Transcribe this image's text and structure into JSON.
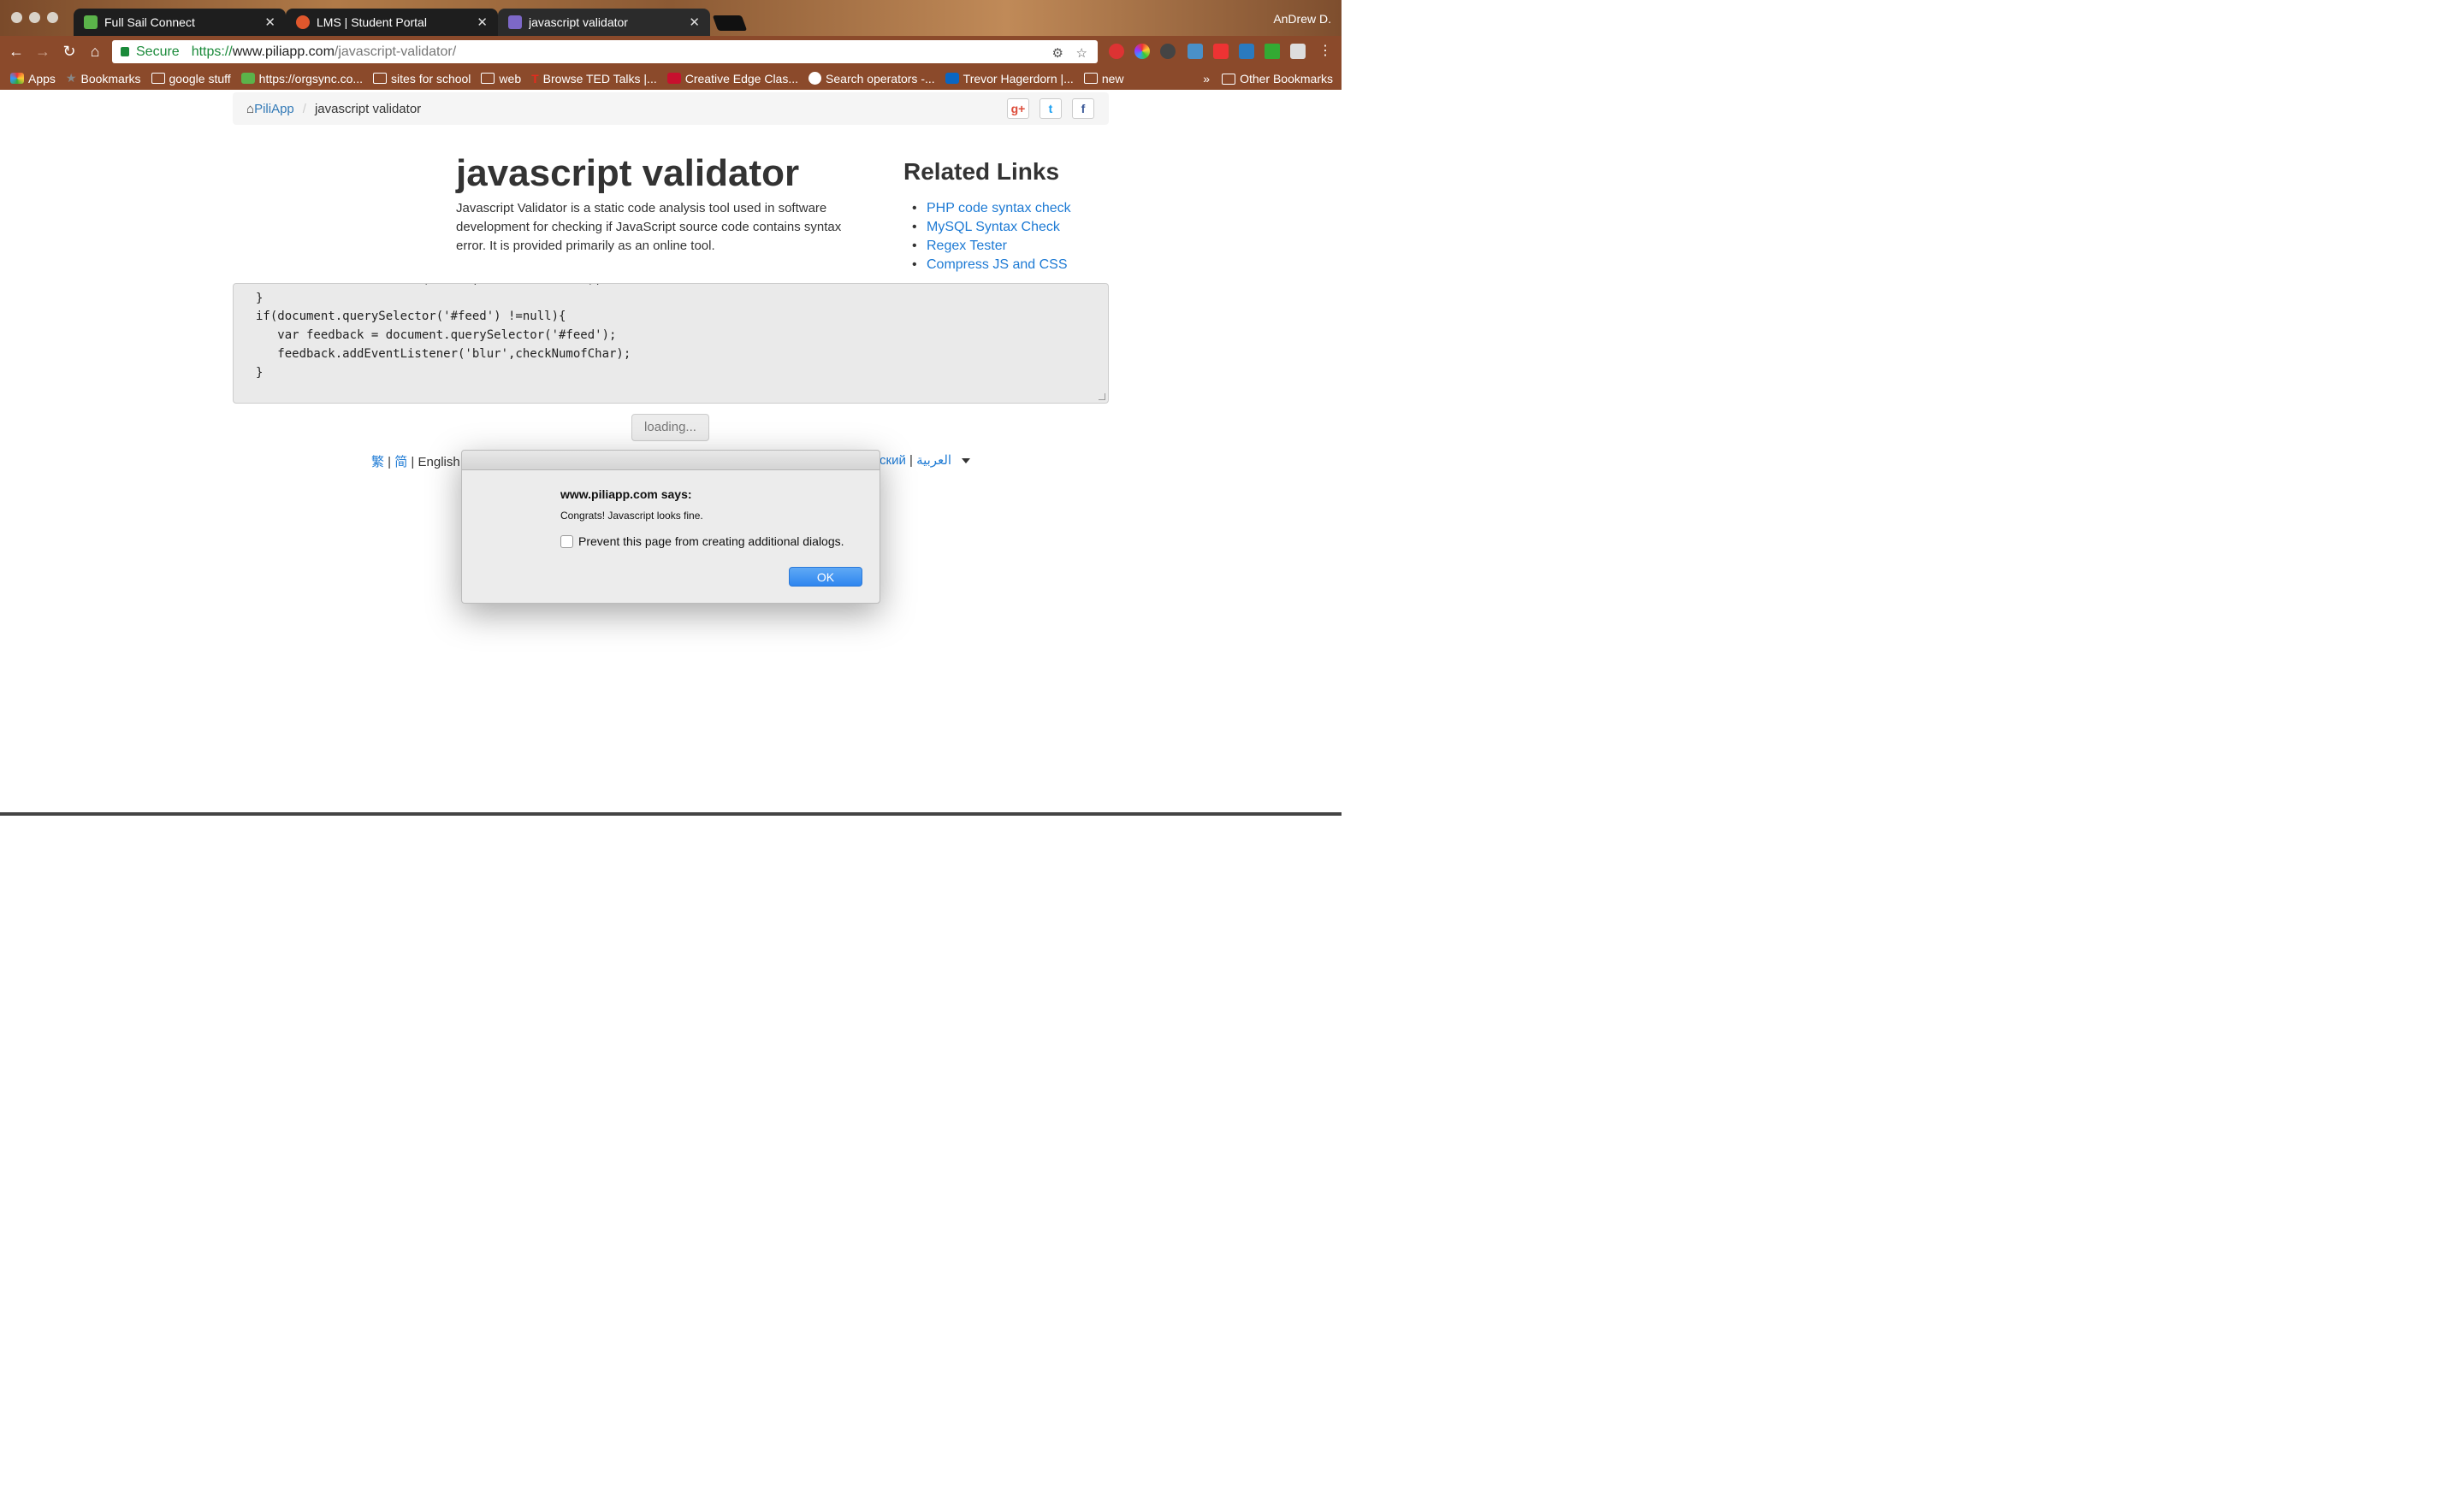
{
  "browser": {
    "profile_name": "AnDrew D.",
    "tabs": [
      {
        "title": "Full Sail Connect",
        "icon": "full-sail-icon",
        "color": "#5bb34a"
      },
      {
        "title": "LMS | Student Portal",
        "icon": "lms-icon",
        "color": "#e0572c"
      },
      {
        "title": "javascript validator",
        "icon": "piliapp-icon",
        "color": "#7d68c8"
      }
    ],
    "secure_label": "Secure",
    "url_scheme": "https://",
    "url_host": "www.piliapp.com",
    "url_path": "/javascript-validator/",
    "bookmarks": [
      {
        "label": "Apps",
        "icon": "apps-grid-icon"
      },
      {
        "label": "Bookmarks",
        "icon": "star-icon"
      },
      {
        "label": "google stuff",
        "icon": "folder-icon"
      },
      {
        "label": "https://orgsync.co...",
        "icon": "orgsync-icon"
      },
      {
        "label": "sites for school",
        "icon": "folder-icon"
      },
      {
        "label": "web",
        "icon": "folder-icon"
      },
      {
        "label": "Browse TED Talks |...",
        "icon": "ted-icon"
      },
      {
        "label": "Creative Edge Clas...",
        "icon": "creative-edge-icon"
      },
      {
        "label": "Search operators -...",
        "icon": "google-icon"
      },
      {
        "label": "Trevor Hagerdorn |...",
        "icon": "linkedin-icon"
      },
      {
        "label": "new",
        "icon": "folder-icon"
      }
    ],
    "overflow": "»",
    "other_bookmarks": "Other Bookmarks"
  },
  "page": {
    "breadcrumb_home": "PiliApp",
    "breadcrumb_separator": "/",
    "breadcrumb_current": "javascript validator",
    "social": {
      "google_plus": "g+",
      "twitter": "t",
      "facebook": "f"
    },
    "title": "javascript validator",
    "description": "Javascript Validator is a static code analysis tool used in software development for checking if JavaScript source code contains syntax error. It is provided primarily as an online tool.",
    "related_title": "Related Links",
    "related_links": [
      "PHP code syntax check",
      "MySQL Syntax Check",
      "Regex Tester",
      "Compress JS and CSS"
    ],
    "code": "  name.addEventListener('blur',fullNamechecker);\n}\nif(document.querySelector('#feed') !=null){\n   var feedback = document.querySelector('#feed');\n   feedback.addEventListener('blur',checkNumofChar);\n}",
    "code_partial_top": "  name.addEventListener('blur',fullNamechecker);",
    "button_label": "loading...",
    "lang_trad": "繁",
    "lang_simp": "简",
    "lang_english": "English",
    "lang_sep": " | ",
    "lang_russian_partial": "ский",
    "lang_arabic": "العربية"
  },
  "dialog": {
    "heading": "www.piliapp.com says:",
    "message": "Congrats! Javascript looks fine.",
    "checkbox_label": "Prevent this page from creating additional dialogs.",
    "ok_label": "OK"
  }
}
